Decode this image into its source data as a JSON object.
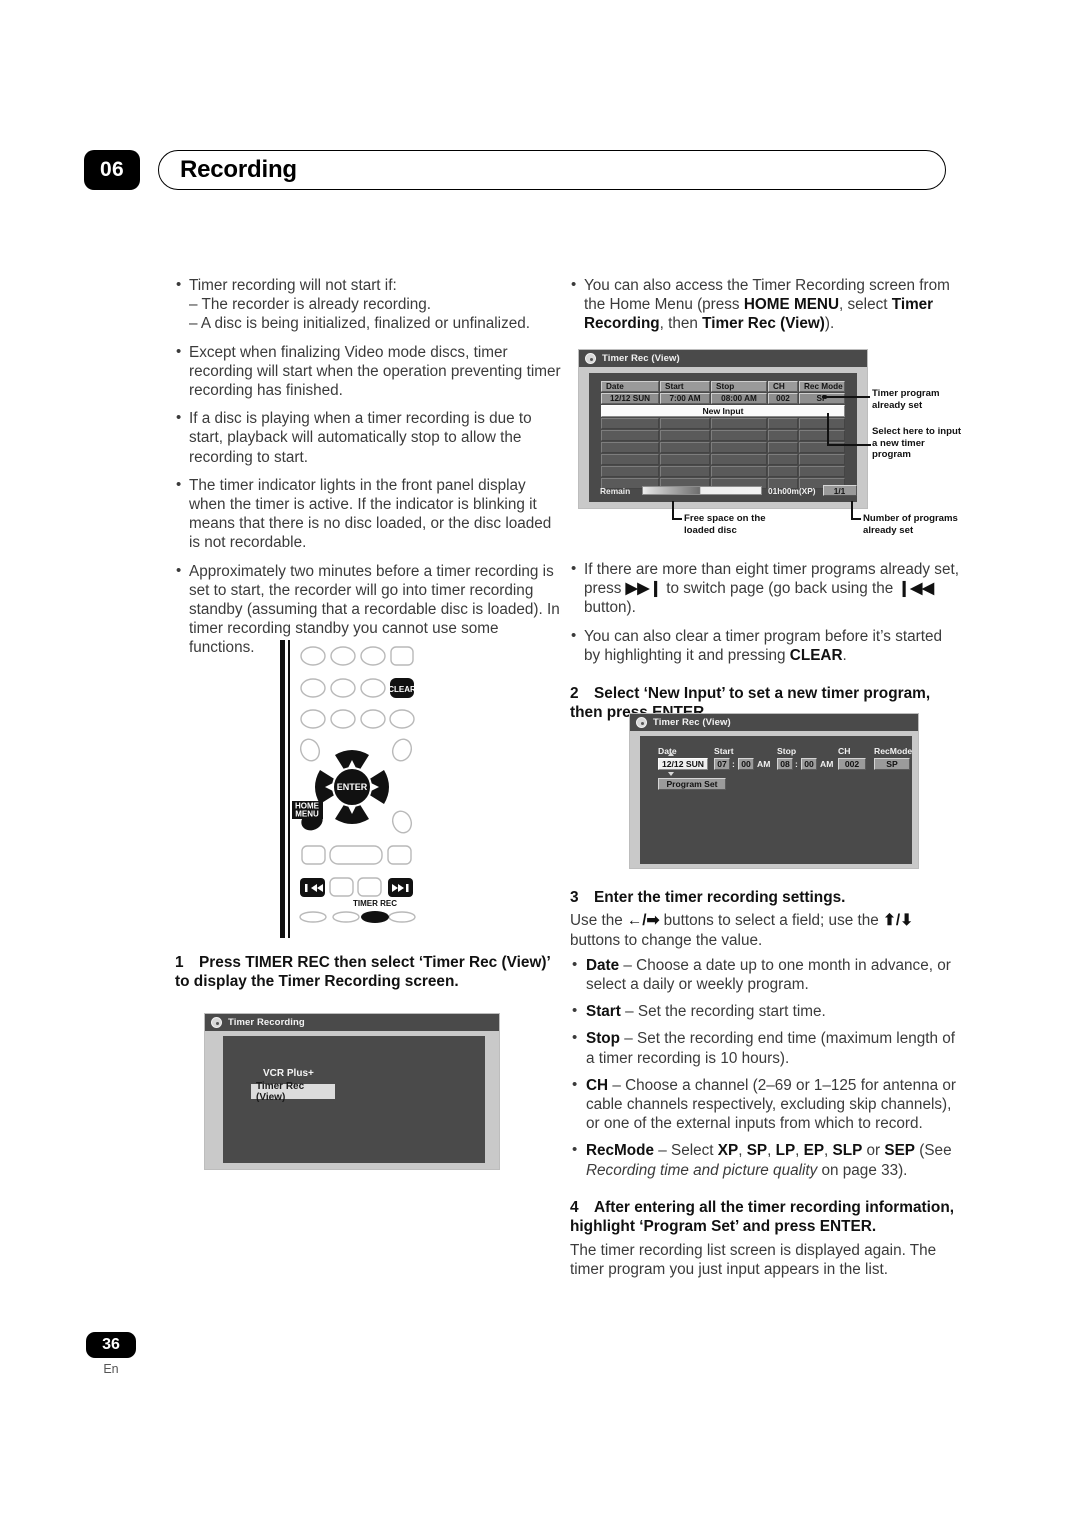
{
  "header": {
    "chapter_number": "06",
    "title": "Recording"
  },
  "footer": {
    "page_number": "36",
    "language": "En"
  },
  "left_column": {
    "bullets": [
      {
        "text": "Timer recording will not start if:",
        "sublines": [
          "– The recorder is already recording.",
          "– A disc is being initialized, finalized or unfinalized."
        ]
      },
      {
        "text": "Except when finalizing Video mode discs, timer recording will start when the operation preventing timer recording has finished."
      },
      {
        "text": "If a disc is playing when a timer recording is due to start, playback will automatically stop to allow the recording to start."
      },
      {
        "text": "The timer indicator lights in the front panel display when the timer is active. If the indicator is blinking it means that there is no disc loaded, or the disc loaded is not recordable."
      },
      {
        "text": "Approximately two minutes before a timer recording is set to start, the recorder will go into timer recording standby (assuming that a recordable disc is loaded). In timer recording standby you cannot use some functions."
      }
    ],
    "step1": {
      "num": "1",
      "text": "Press TIMER REC then select ‘Timer Rec (View)’ to display the Timer Recording screen."
    }
  },
  "remote": {
    "clear_label": "CLEAR",
    "enter_label": "ENTER",
    "home_menu_label_line1": "HOME",
    "home_menu_label_line2": "MENU",
    "timer_rec_label": "TIMER REC",
    "prev_icon": "skip-back-icon",
    "next_icon": "skip-forward-icon",
    "up_icon": "arrow-up-icon",
    "down_icon": "arrow-down-icon",
    "left_icon": "arrow-left-icon",
    "right_icon": "arrow-right-icon"
  },
  "right_column": {
    "bullet_home_menu_prefix": "You can also access the Timer Recording screen from the Home Menu (press ",
    "bullet_home_menu_b1": "HOME MENU",
    "bullet_home_menu_mid": ", select ",
    "bullet_home_menu_b2": "Timer Recording",
    "bullet_home_menu_mid2": ", then ",
    "bullet_home_menu_b3": "Timer Rec (View)",
    "bullet_home_menu_suffix": ").",
    "bullet_pages_part1": "If there are more than eight timer programs already set, press ",
    "bullet_pages_icon1": "▶▶❙",
    "bullet_pages_part2": " to switch page (go back using the ",
    "bullet_pages_icon2": "❙◀◀",
    "bullet_pages_part3": " button).",
    "bullet_clear_part1": "You can also clear a timer program before it’s started by highlighting it and pressing ",
    "bullet_clear_bold": "CLEAR",
    "bullet_clear_part2": ".",
    "step2": {
      "num": "2",
      "text": "Select ‘New Input’ to set a new timer program, then press ENTER."
    },
    "step3": {
      "num": "3",
      "text": "Enter the timer recording settings."
    },
    "step3_intro_a": "Use the ",
    "step3_icon_lr": "←/➡",
    "step3_intro_b": " buttons to select a field; use the ",
    "step3_icon_ud": "⬆/⬇",
    "step3_intro_c": " buttons to change the value.",
    "settings": [
      {
        "term": "Date",
        "desc": " – Choose a date up to one month in advance, or select a daily or weekly program."
      },
      {
        "term": "Start",
        "desc": " – Set the recording start time."
      },
      {
        "term": "Stop",
        "desc": " – Set the recording end time (maximum length of a timer recording is 10 hours)."
      },
      {
        "term": "CH",
        "desc": " – Choose a channel (2–69 or 1–125 for antenna or cable channels respectively, excluding skip channels), or one of the external inputs from which to record."
      }
    ],
    "recmode": {
      "term": "RecMode",
      "pre": " – Select ",
      "modes": [
        "XP",
        "SP",
        "LP",
        "EP",
        "SLP"
      ],
      "or_word": " or ",
      "last_mode": "SEP",
      "see_text": " (See ",
      "italic_ref": "Recording time and picture quality",
      "page_ref": " on page 33)."
    },
    "step4": {
      "num": "4",
      "text": "After entering all the timer recording information, highlight ‘Program Set’ and press ENTER."
    },
    "step4_body": "The timer recording list screen is displayed again. The timer program you just input appears in the list."
  },
  "screens": {
    "timer_recording_menu": {
      "title": "Timer Recording",
      "disc_icon": "disc-icon",
      "label_vcr_plus": "VCR Plus+",
      "selected_item": "Timer Rec (View)"
    },
    "timer_rec_view_list": {
      "title": "Timer Rec (View)",
      "disc_icon": "disc-icon",
      "columns": [
        "Date",
        "Start",
        "Stop",
        "CH",
        "Rec Mode"
      ],
      "rows": [
        [
          "12/12 SUN",
          "7:00 AM",
          "08:00 AM",
          "002",
          "SP"
        ]
      ],
      "new_input_label": "New Input",
      "empty_rows": 6,
      "remain_label": "Remain",
      "remain_time": "01h00m(XP)",
      "page_count": "1/1",
      "callouts": [
        "Timer program\nalready set",
        "Select here to\ninput a new\ntimer program",
        "Free space on the\nloaded disc",
        "Number of programs\nalready set"
      ],
      "callout_1": "Timer program already set",
      "callout_2": "Select here to input a new timer program",
      "callout_3": "Free space on the loaded disc",
      "callout_4": "Number of programs already set"
    },
    "program_set": {
      "title": "Timer Rec (View)",
      "disc_icon": "disc-icon",
      "headings": [
        "Date",
        "Start",
        "Stop",
        "CH",
        "RecMode"
      ],
      "date_value": "12/12 SUN",
      "start_hour": "07",
      "start_min": "00",
      "start_ampm": "AM",
      "stop_hour": "08",
      "stop_min": "00",
      "stop_ampm": "AM",
      "ch_value": "002",
      "recmode_value": "SP",
      "colon": ":",
      "program_set_button": "Program Set"
    }
  }
}
